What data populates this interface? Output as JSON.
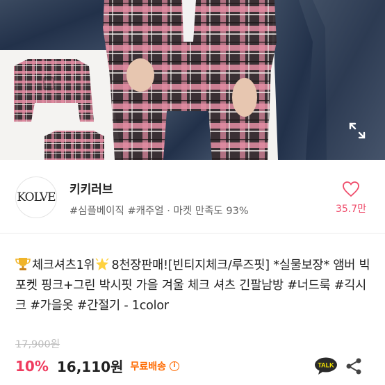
{
  "store": {
    "logo_text": "KOLVE",
    "name": "키키러브",
    "tags": "#심플베이직 #캐주얼 · 마켓 만족도 93%",
    "like_count": "35.7만"
  },
  "product": {
    "title_part1": "체크셔츠1위",
    "title_part2": "8천장판매![빈티지체크/루즈핏] *실물보장* 앰버 빅포켓 핑크+그린 박시핏 가을 겨울 체크 셔츠 긴팔남방 #너드룩 #긱시크 #가을옷 #간절기 - 1color",
    "original_price": "17,900원",
    "discount": "10%",
    "price": "16,110원",
    "shipping": "무료배송",
    "info_symbol": "i"
  },
  "actions": {
    "talk_label": "TALK"
  },
  "colors": {
    "accent_pink": "#ef3b5e",
    "shipping_orange": "#ff6a00",
    "plaid_pink": "#e08aa0",
    "plaid_dark": "#2b2528"
  },
  "icons": [
    "trophy-icon",
    "star-icon",
    "heart-icon",
    "expand-icon",
    "info-icon",
    "kakao-talk-icon",
    "share-icon"
  ]
}
